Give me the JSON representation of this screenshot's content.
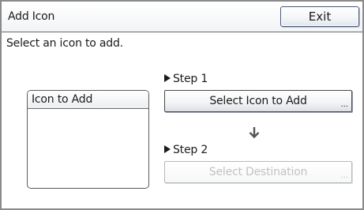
{
  "header": {
    "title": "Add Icon",
    "exit_label": "Exit"
  },
  "instruction": "Select an icon to add.",
  "icon_list": {
    "header": "Icon to Add",
    "items": []
  },
  "step1": {
    "label": "Step 1",
    "button_label": "Select Icon to Add",
    "button_suffix": "...",
    "enabled": true
  },
  "step2": {
    "label": "Step 2",
    "button_label": "Select Destination",
    "button_suffix": "...",
    "enabled": false
  },
  "icons": {
    "step_marker": "right-triangle-icon",
    "flow_arrow": "down-arrow-icon"
  },
  "colors": {
    "border": "#8a8a8a",
    "button_border": "#4a5a78",
    "disabled_text": "#c2c2c2"
  }
}
